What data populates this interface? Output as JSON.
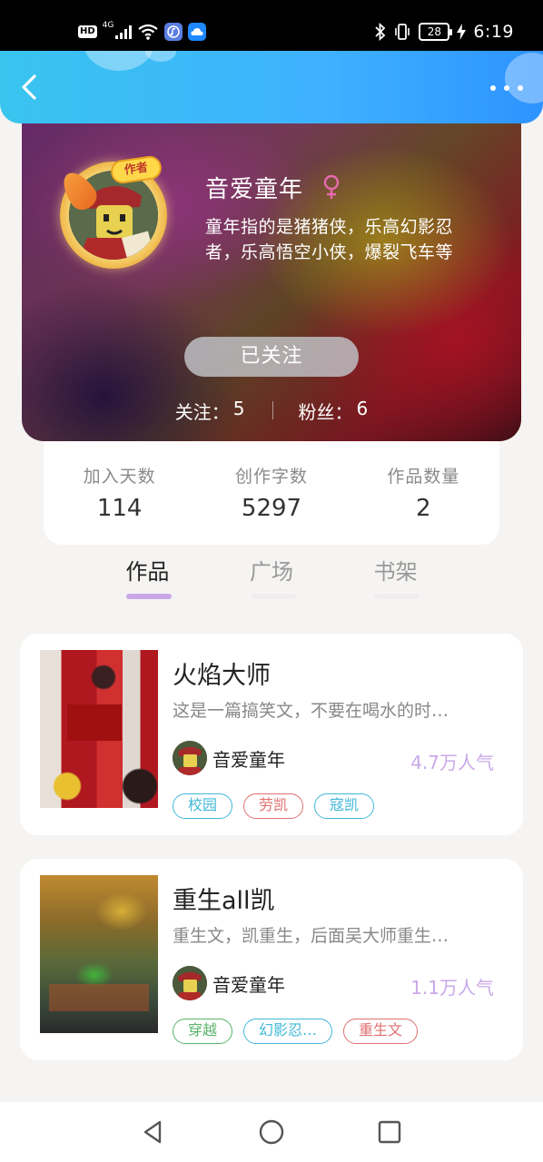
{
  "status_bar": {
    "hd_label": "HD",
    "network_label": "4G",
    "battery": "28",
    "time": "6:19"
  },
  "nav": {
    "back_icon": "chevron-left-icon",
    "more_icon": "more-dots-icon"
  },
  "profile": {
    "author_badge": "作者",
    "name": "音爱童年",
    "gender_symbol": "♀",
    "bio": "童年指的是猪猪侠，乐高幻影忍者，乐高悟空小侠，爆裂飞车等",
    "follow_button": "已关注",
    "following_label": "关注：",
    "following_count": "5",
    "followers_label": "粉丝：",
    "followers_count": "6"
  },
  "stats": [
    {
      "label": "加入天数",
      "value": "114"
    },
    {
      "label": "创作字数",
      "value": "5297"
    },
    {
      "label": "作品数量",
      "value": "2"
    }
  ],
  "tabs": [
    {
      "label": "作品",
      "active": true
    },
    {
      "label": "广场",
      "active": false
    },
    {
      "label": "书架",
      "active": false
    }
  ],
  "books": [
    {
      "title": "火焰大师",
      "description": "这是一篇搞笑文，不要在喝水的时…",
      "author": "音爱童年",
      "popularity": "4.7万人气",
      "tags": [
        {
          "label": "校园",
          "color": "#40b8d8"
        },
        {
          "label": "劳凯",
          "color": "#e07070"
        },
        {
          "label": "寇凯",
          "color": "#40b8d8"
        }
      ]
    },
    {
      "title": "重生all凯",
      "description": "重生文，凯重生，后面吴大师重生…",
      "author": "音爱童年",
      "popularity": "1.1万人气",
      "tags": [
        {
          "label": "穿越",
          "color": "#5ab46a"
        },
        {
          "label": "幻影忍…",
          "color": "#40b8d8"
        },
        {
          "label": "重生文",
          "color": "#e07070"
        }
      ]
    }
  ],
  "colors": {
    "nav_gradient_start": "#39c4ee",
    "nav_gradient_end": "#2e93ff",
    "tab_active_underline": "#c9a8e8",
    "popularity": "#c9a8e8"
  }
}
